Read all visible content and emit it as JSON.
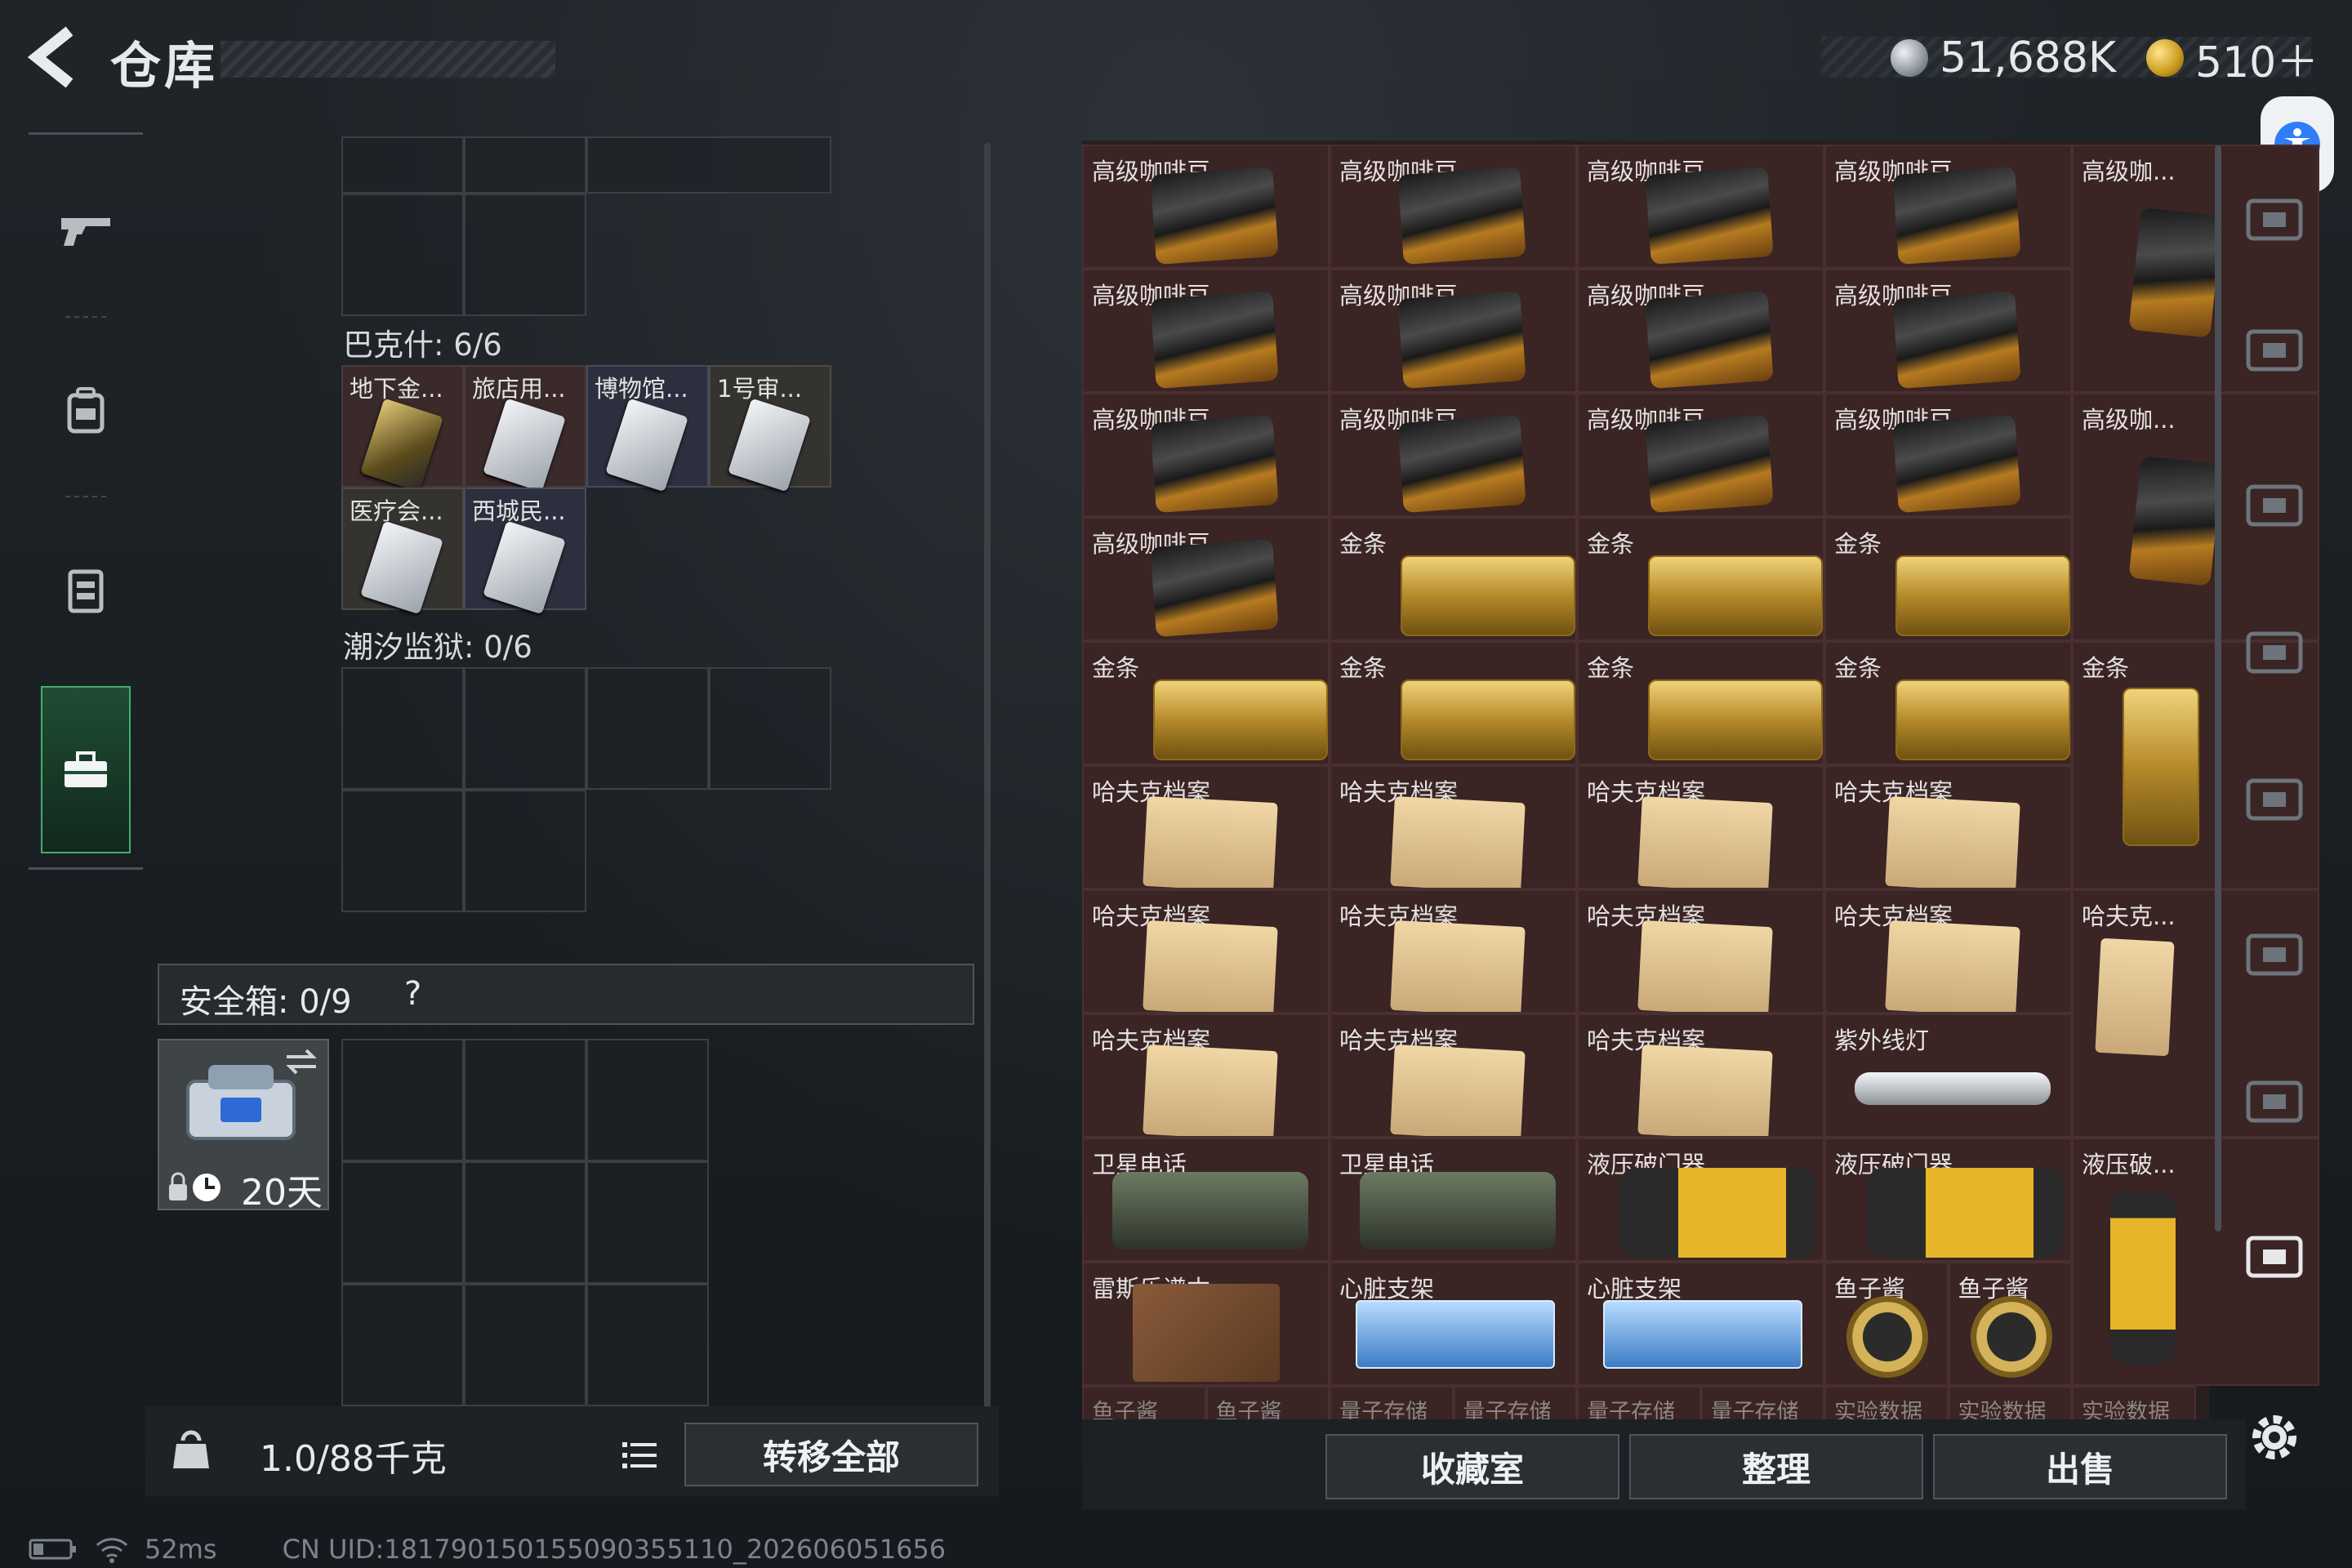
{
  "header": {
    "title": "仓库",
    "currency_silver": "51,688K",
    "currency_gold": "510＋"
  },
  "left_rail": {
    "items": [
      {
        "icon": "gun-icon"
      },
      {
        "icon": "backpack-icon"
      },
      {
        "icon": "vest-icon"
      },
      {
        "icon": "toolbox-icon"
      }
    ]
  },
  "storage": {
    "section_bakshi_label": "巴克什: 6/6",
    "cards": [
      "地下金...",
      "旅店用...",
      "博物馆...",
      "1号审...",
      "医疗会...",
      "西城民..."
    ],
    "section_tide_prison_label": "潮汐监狱: 0/6"
  },
  "safebox": {
    "title": "安全箱:  0/9",
    "help": "?",
    "timer": "20天"
  },
  "footer_left": {
    "weight": "1.0/88千克",
    "transfer_all": "转移全部"
  },
  "status_bar": {
    "ping": "52ms",
    "uid": "CN UID:1817901501550903551​10_202606051656"
  },
  "grid_items": [
    {
      "name": "高级咖啡豆",
      "type": "coffee",
      "row": 0,
      "col": 0
    },
    {
      "name": "高级咖啡豆",
      "type": "coffee",
      "row": 0,
      "col": 1
    },
    {
      "name": "高级咖啡豆",
      "type": "coffee",
      "row": 0,
      "col": 2
    },
    {
      "name": "高级咖啡豆",
      "type": "coffee",
      "row": 0,
      "col": 3
    },
    {
      "name": "高级咖...",
      "type": "coffee-tall",
      "row": 0,
      "col": 4
    },
    {
      "name": "高级咖啡豆",
      "type": "coffee",
      "row": 1,
      "col": 0
    },
    {
      "name": "高级咖啡豆",
      "type": "coffee",
      "row": 1,
      "col": 1
    },
    {
      "name": "高级咖啡豆",
      "type": "coffee",
      "row": 1,
      "col": 2
    },
    {
      "name": "高级咖啡豆",
      "type": "coffee",
      "row": 1,
      "col": 3
    },
    {
      "name": "高级咖啡豆",
      "type": "coffee",
      "row": 2,
      "col": 0
    },
    {
      "name": "高级咖啡豆",
      "type": "coffee",
      "row": 2,
      "col": 1
    },
    {
      "name": "高级咖啡豆",
      "type": "coffee",
      "row": 2,
      "col": 2
    },
    {
      "name": "高级咖啡豆",
      "type": "coffee",
      "row": 2,
      "col": 3
    },
    {
      "name": "高级咖...",
      "type": "coffee-tall",
      "row": 2,
      "col": 4
    },
    {
      "name": "高级咖啡豆",
      "type": "coffee",
      "row": 3,
      "col": 0
    },
    {
      "name": "金条",
      "type": "gold",
      "row": 3,
      "col": 1
    },
    {
      "name": "金条",
      "type": "gold",
      "row": 3,
      "col": 2
    },
    {
      "name": "金条",
      "type": "gold",
      "row": 3,
      "col": 3
    },
    {
      "name": "金条",
      "type": "gold",
      "row": 4,
      "col": 0
    },
    {
      "name": "金条",
      "type": "gold",
      "row": 4,
      "col": 1
    },
    {
      "name": "金条",
      "type": "gold",
      "row": 4,
      "col": 2
    },
    {
      "name": "金条",
      "type": "gold",
      "row": 4,
      "col": 3
    },
    {
      "name": "金条",
      "type": "gold-tall",
      "row": 4,
      "col": 4
    },
    {
      "name": "哈夫克档案",
      "type": "folder",
      "row": 5,
      "col": 0
    },
    {
      "name": "哈夫克档案",
      "type": "folder",
      "row": 5,
      "col": 1
    },
    {
      "name": "哈夫克档案",
      "type": "folder",
      "row": 5,
      "col": 2
    },
    {
      "name": "哈夫克档案",
      "type": "folder",
      "row": 5,
      "col": 3
    },
    {
      "name": "哈夫克档案",
      "type": "folder",
      "row": 6,
      "col": 0
    },
    {
      "name": "哈夫克档案",
      "type": "folder",
      "row": 6,
      "col": 1
    },
    {
      "name": "哈夫克档案",
      "type": "folder",
      "row": 6,
      "col": 2
    },
    {
      "name": "哈夫克档案",
      "type": "folder",
      "row": 6,
      "col": 3
    },
    {
      "name": "哈夫克...",
      "type": "folder-tall",
      "row": 6,
      "col": 4
    },
    {
      "name": "哈夫克档案",
      "type": "folder",
      "row": 7,
      "col": 0
    },
    {
      "name": "哈夫克档案",
      "type": "folder",
      "row": 7,
      "col": 1
    },
    {
      "name": "哈夫克档案",
      "type": "folder",
      "row": 7,
      "col": 2
    },
    {
      "name": "紫外线灯",
      "type": "uv",
      "row": 7,
      "col": 3
    },
    {
      "name": "卫星电话",
      "type": "phone",
      "row": 8,
      "col": 0
    },
    {
      "name": "卫星电话",
      "type": "phone",
      "row": 8,
      "col": 1
    },
    {
      "name": "液压破门器",
      "type": "breach",
      "row": 8,
      "col": 2
    },
    {
      "name": "液压破门器",
      "type": "breach",
      "row": 8,
      "col": 3
    },
    {
      "name": "液压破...",
      "type": "breach-tall",
      "row": 8,
      "col": 4
    },
    {
      "name": "雷斯乐谱本",
      "type": "book",
      "row": 9,
      "col": 0
    },
    {
      "name": "心脏支架",
      "type": "stent",
      "row": 9,
      "col": 1
    },
    {
      "name": "心脏支架",
      "type": "stent",
      "row": 9,
      "col": 2
    },
    {
      "name": "鱼子酱",
      "type": "caviar-half",
      "row": 9,
      "col": 3
    },
    {
      "name": "鱼子酱",
      "type": "caviar-half2",
      "row": 9,
      "col": 3
    }
  ],
  "grid_partial_row": [
    "鱼子酱",
    "鱼子酱",
    "量子存储",
    "量子存储",
    "量子存储",
    "量子存储",
    "实验数据",
    "实验数据",
    "实验数据"
  ],
  "footer_right": {
    "collection": "收藏室",
    "sort": "整理",
    "sell": "出售"
  },
  "right_side": {
    "icons": [
      "home-icon",
      "add-container-icon",
      "add-container-icon",
      "folder-stack-icon",
      "folder-stack-icon",
      "vault-icon",
      "vault-icon",
      "vault-search-icon"
    ]
  }
}
